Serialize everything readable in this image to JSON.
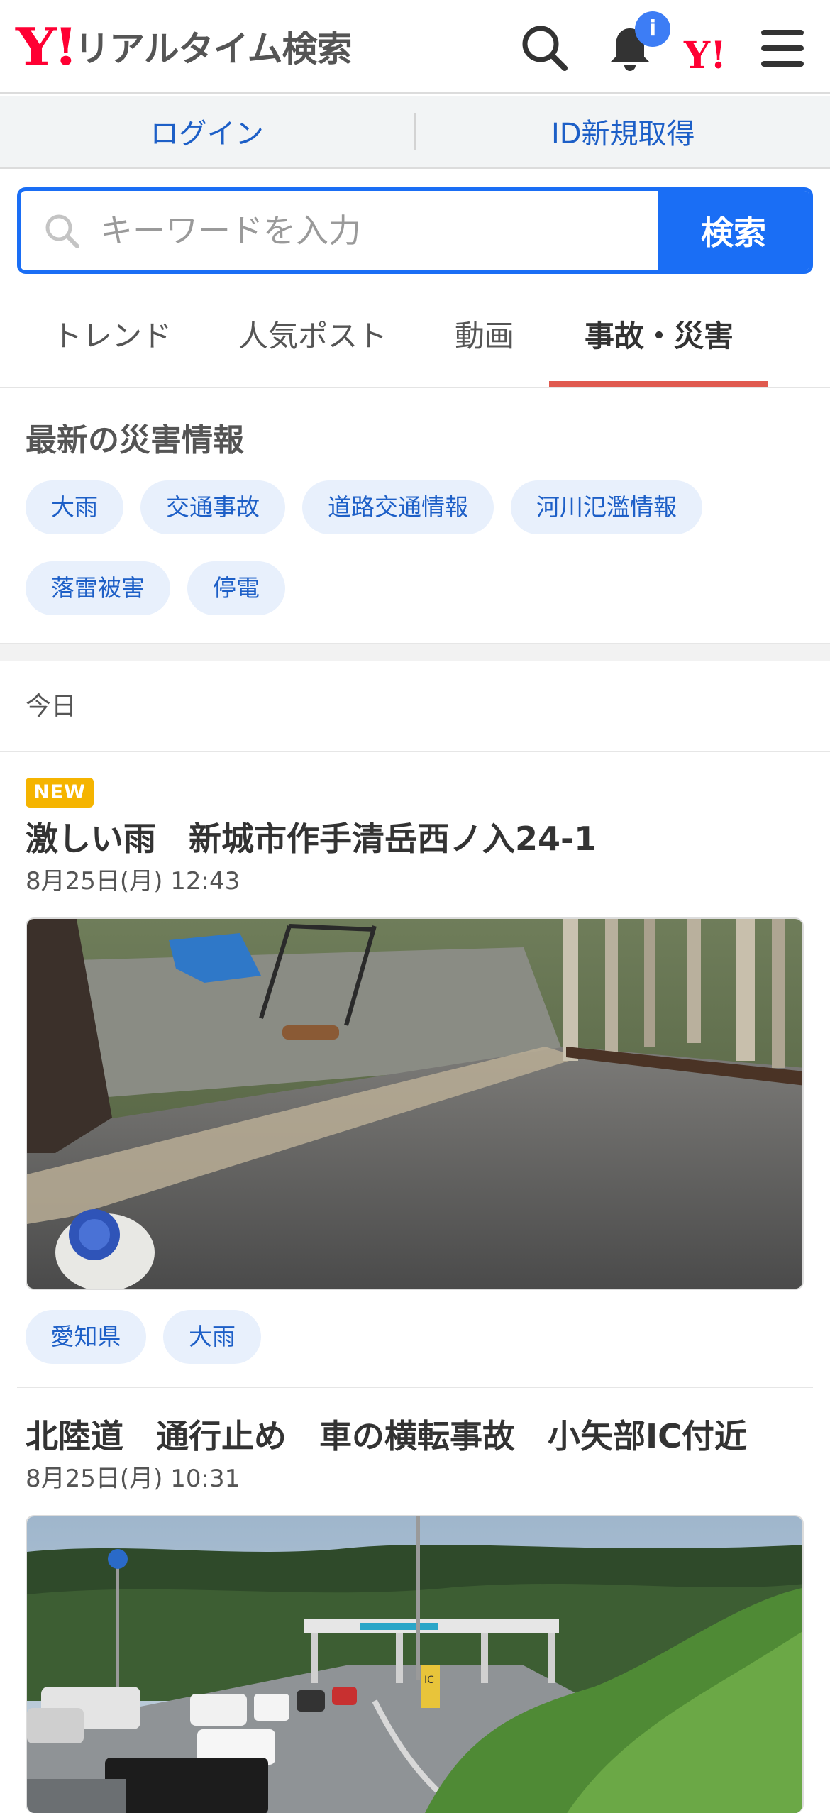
{
  "header": {
    "logo_y": "Y!",
    "logo_text": "リアルタイム検索",
    "notification_badge": "i",
    "yj_logo": "Y!",
    "icons": [
      "search-icon",
      "bell-icon",
      "yahoo-japan-icon",
      "hamburger-menu-icon"
    ]
  },
  "account": {
    "login_label": "ログイン",
    "signup_label": "ID新規取得"
  },
  "search": {
    "placeholder": "キーワードを入力",
    "value": "",
    "button_label": "検索"
  },
  "tabs": [
    {
      "label": "トレンド",
      "active": false
    },
    {
      "label": "人気ポスト",
      "active": false
    },
    {
      "label": "動画",
      "active": false
    },
    {
      "label": "事故・災害",
      "active": true
    }
  ],
  "disaster": {
    "title": "最新の災害情報",
    "chips": [
      "大雨",
      "交通事故",
      "道路交通情報",
      "河川氾濫情報",
      "落雷被害",
      "停電"
    ]
  },
  "feed": {
    "day_label": "今日",
    "posts": [
      {
        "badge": "NEW",
        "title": "激しい雨　新城市作手清岳西ノ入24-1",
        "time": "8月25日(月) 12:43",
        "tags": [
          "愛知県",
          "大雨"
        ]
      },
      {
        "title": "北陸道　通行止め　車の横転事故　小矢部IC付近",
        "time": "8月25日(月) 10:31",
        "toll_sign": "IC"
      }
    ]
  },
  "colors": {
    "brand_red": "#ff0033",
    "accent_blue": "#1a6ef5",
    "link_blue": "#1d5fc7",
    "chip_bg": "#e8f0fc",
    "tab_underline": "#e05a4f",
    "new_badge": "#f5b400"
  }
}
